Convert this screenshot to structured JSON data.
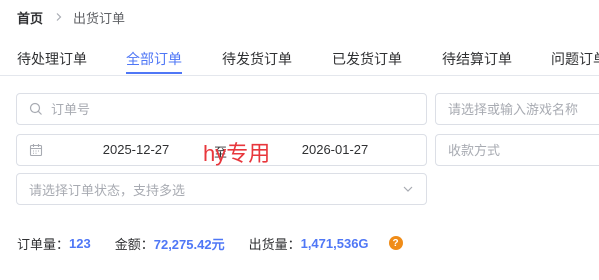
{
  "breadcrumb": {
    "home": "首页",
    "current": "出货订单"
  },
  "tabs": [
    {
      "label": "待处理订单",
      "active": false
    },
    {
      "label": "全部订单",
      "active": true
    },
    {
      "label": "待发货订单",
      "active": false
    },
    {
      "label": "已发货订单",
      "active": false
    },
    {
      "label": "待结算订单",
      "active": false
    },
    {
      "label": "问题订单",
      "active": false
    }
  ],
  "filters": {
    "order_no_placeholder": "订单号",
    "game_placeholder": "请选择或输入游戏名称",
    "date_start": "2025-12-27",
    "date_separator": "至",
    "date_end": "2026-01-27",
    "payment_placeholder": "收款方式",
    "status_placeholder": "请选择订单状态，支持多选"
  },
  "watermark": "hy专用",
  "stats": {
    "order_count_label": "订单量：",
    "order_count": "123",
    "amount_label": "金额：",
    "amount": "72,275.42元",
    "shipped_label": "出货量：",
    "shipped": "1,471,536G",
    "help_symbol": "?"
  },
  "colors": {
    "accent": "#4f77f6",
    "help": "#f08c18",
    "watermark": "#e8373c"
  }
}
